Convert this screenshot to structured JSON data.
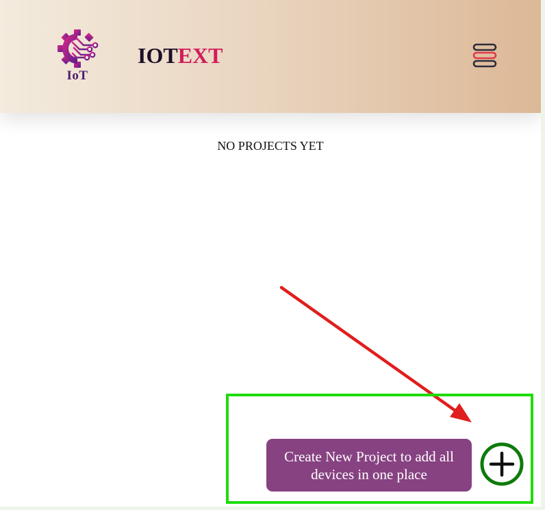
{
  "header": {
    "logo_text": "IoT",
    "brand_part1": "IOT",
    "brand_part2": "EXT",
    "menu_icon": "hamburger-menu-icon"
  },
  "main": {
    "empty_message": "NO PROJECTS YET"
  },
  "fab": {
    "tooltip": "Create New Project to add all devices in one place",
    "icon": "plus-circle-icon"
  },
  "colors": {
    "brand_dark": "#1b0f28",
    "brand_accent": "#d11d5b",
    "tooltip_bg": "#874282",
    "fab_green": "#0f7a0b",
    "highlight_green": "#1fdc0b",
    "arrow_red": "#e01e1e"
  }
}
